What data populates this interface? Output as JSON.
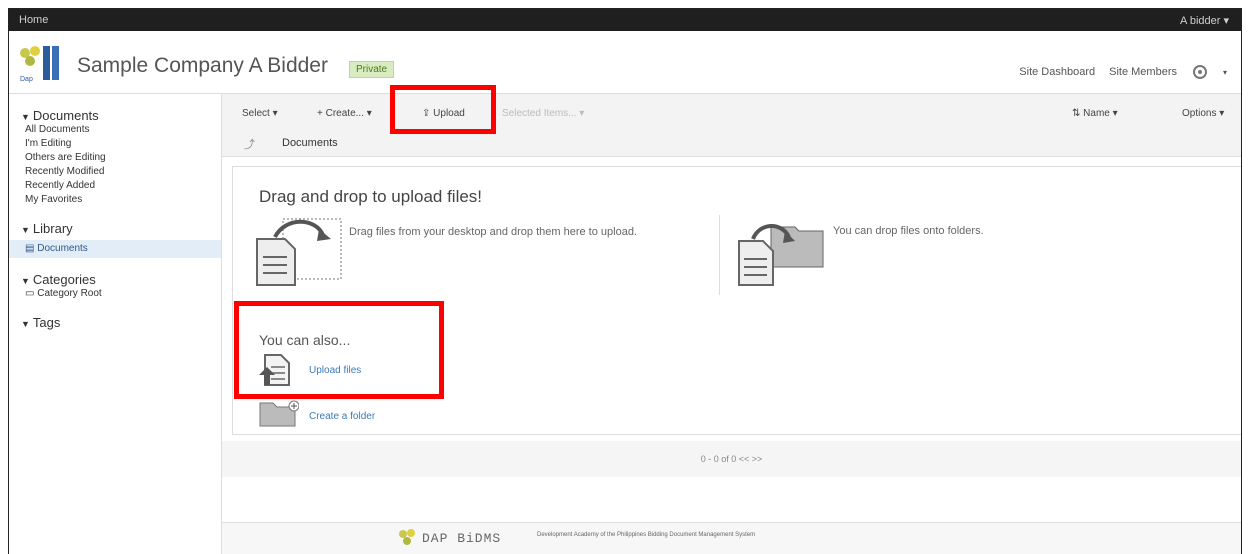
{
  "topbar": {
    "home": "Home",
    "user": "A bidder ▾"
  },
  "header": {
    "site_title": "Sample Company A Bidder",
    "visibility_badge": "Private",
    "links": [
      "Site Dashboard",
      "Site Members"
    ]
  },
  "sidebar": {
    "documents_heading": "Documents",
    "document_filters": [
      "All Documents",
      "I'm Editing",
      "Others are Editing",
      "Recently Modified",
      "Recently Added",
      "My Favorites"
    ],
    "library_heading": "Library",
    "library_item": "Documents",
    "categories_heading": "Categories",
    "category_root": "Category Root",
    "tags_heading": "Tags"
  },
  "toolbar": {
    "select": "Select ▾",
    "create": "+ Create... ▾",
    "upload": "Upload",
    "selected_items": "Selected Items... ▾",
    "sort": "Name ▾",
    "options": "Options ▾"
  },
  "breadcrumb": {
    "label": "Documents"
  },
  "upload_panel": {
    "title": "Drag and drop to upload files!",
    "drag_text": "Drag files from your desktop and drop them here to upload.",
    "drop_text": "You can drop files onto folders.",
    "also_title": "You can also...",
    "upload_files": "Upload files",
    "create_folder": "Create a folder"
  },
  "pagination": {
    "text": "0 - 0 of 0   <<   >>"
  },
  "footer": {
    "brand": "DAP BiDMS",
    "line1": "Development Academy of the Philippines Bidding Document Management System"
  },
  "colors": {
    "highlight": "#ff0000",
    "link": "#3d7ab8",
    "topbar": "#1f1f1f"
  }
}
